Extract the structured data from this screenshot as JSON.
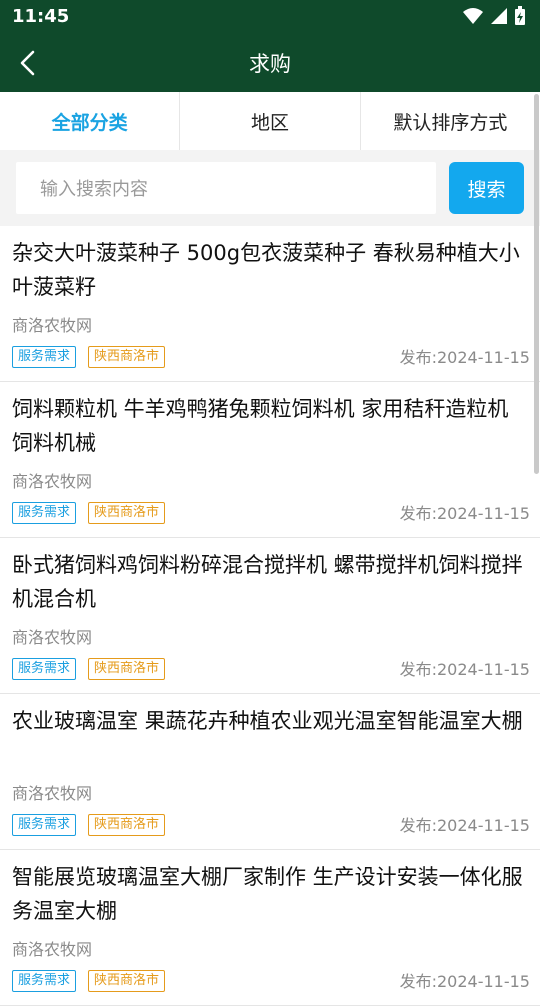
{
  "status_bar": {
    "time": "11:45"
  },
  "app_bar": {
    "title": "求购"
  },
  "filters": [
    {
      "label": "全部分类",
      "active": true
    },
    {
      "label": "地区",
      "active": false
    },
    {
      "label": "默认排序方式",
      "active": false
    }
  ],
  "search": {
    "placeholder": "输入搜索内容",
    "button_label": "搜索"
  },
  "colors": {
    "header": "#0f4a2b",
    "accent": "#1aa3e2",
    "tag_orange": "#e59b1b"
  },
  "items": [
    {
      "title": "杂交大叶菠菜种子 500g包衣菠菜种子 春秋易种植大小叶菠菜籽",
      "source": "商洛农牧网",
      "tag1": "服务需求",
      "tag2": "陕西商洛市",
      "date": "发布:2024-11-15"
    },
    {
      "title": "饲料颗粒机 牛羊鸡鸭猪兔颗粒饲料机 家用秸秆造粒机 饲料机械",
      "source": "商洛农牧网",
      "tag1": "服务需求",
      "tag2": "陕西商洛市",
      "date": "发布:2024-11-15"
    },
    {
      "title": "卧式猪饲料鸡饲料粉碎混合搅拌机 螺带搅拌机饲料搅拌机混合机",
      "source": "商洛农牧网",
      "tag1": "服务需求",
      "tag2": "陕西商洛市",
      "date": "发布:2024-11-15"
    },
    {
      "title": "农业玻璃温室 果蔬花卉种植农业观光温室智能温室大棚",
      "source": "商洛农牧网",
      "tag1": "服务需求",
      "tag2": "陕西商洛市",
      "date": "发布:2024-11-15"
    },
    {
      "title": "智能展览玻璃温室大棚厂家制作 生产设计安装一体化服务温室大棚",
      "source": "商洛农牧网",
      "tag1": "服务需求",
      "tag2": "陕西商洛市",
      "date": "发布:2024-11-15"
    }
  ]
}
